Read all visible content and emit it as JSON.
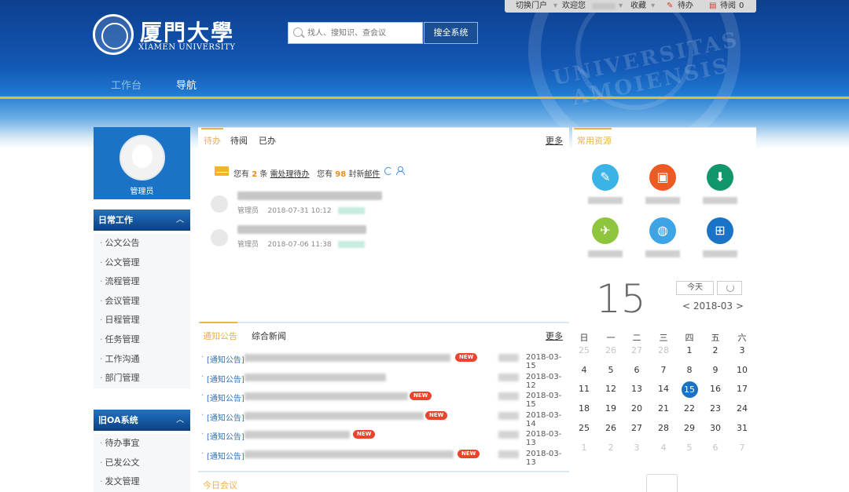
{
  "header": {
    "logo_cn": "厦門大學",
    "logo_en": "XIAMEN UNIVERSITY",
    "search_placeholder": "找人、搜知识、查会议",
    "search_button": "搜全系统",
    "seal_text": "UNIVERSITAS AMOIENSIS",
    "topbar": {
      "switch_portal": "切换门户",
      "welcome": "欢迎您",
      "favorites": "收藏",
      "todo_label": "待办",
      "todo_count": "",
      "toread_label": "待阅",
      "toread_count": "0"
    },
    "nav": [
      "工作台",
      "导航"
    ]
  },
  "sidebar": {
    "user_name": "管理员",
    "section1": {
      "title": "日常工作",
      "items": [
        "公文公告",
        "公文管理",
        "流程管理",
        "会议管理",
        "日程管理",
        "任务管理",
        "工作沟通",
        "部门管理"
      ]
    },
    "section2": {
      "title": "旧OA系统",
      "items": [
        "待办事宜",
        "已发公文",
        "发文管理"
      ]
    }
  },
  "todo": {
    "tabs": [
      "待办",
      "待阅",
      "已办"
    ],
    "more": "更多",
    "summary": {
      "you_have": "您有",
      "count": "2",
      "unit": "条",
      "link": "需处理待办",
      "you_have2": "您有",
      "mail_count": "98",
      "mail_unit": "封新",
      "mail_link": "邮件"
    },
    "items": [
      {
        "user": "管理员",
        "date": "2018-07-31 10:12"
      },
      {
        "user": "管理员",
        "date": "2018-07-06 11:38"
      }
    ]
  },
  "apps": {
    "title": "常用资源",
    "items": [
      {
        "icon": "document-edit-icon",
        "color": "#3cb3e6"
      },
      {
        "icon": "briefcase-icon",
        "color": "#ee5a24"
      },
      {
        "icon": "download-icon",
        "color": "#11956b"
      },
      {
        "icon": "airplane-icon",
        "color": "#8fc53c"
      },
      {
        "icon": "globe-icon",
        "color": "#3da5e6"
      },
      {
        "icon": "grid-icon",
        "color": "#1b73c8"
      }
    ]
  },
  "calendar": {
    "day": "15",
    "today_button": "今天",
    "month": "2018-03",
    "prev": "<",
    "next": ">",
    "weekdays": [
      "日",
      "一",
      "二",
      "三",
      "四",
      "五",
      "六"
    ],
    "weeks": [
      [
        "25",
        "26",
        "27",
        "28",
        "1",
        "2",
        "3"
      ],
      [
        "4",
        "5",
        "6",
        "7",
        "8",
        "9",
        "10"
      ],
      [
        "11",
        "12",
        "13",
        "14",
        "15",
        "16",
        "17"
      ],
      [
        "18",
        "19",
        "20",
        "21",
        "22",
        "23",
        "24"
      ],
      [
        "25",
        "26",
        "27",
        "28",
        "29",
        "30",
        "31"
      ],
      [
        "1",
        "2",
        "3",
        "4",
        "5",
        "6",
        "7"
      ]
    ],
    "selected": "15"
  },
  "news": {
    "tabs": [
      "通知公告",
      "综合新闻"
    ],
    "more": "更多",
    "new_badge": "NEW",
    "items": [
      {
        "category": "[通知公告]",
        "date": "2018-03-15",
        "is_new": true
      },
      {
        "category": "[通知公告]",
        "date": "2018-03-12",
        "is_new": false
      },
      {
        "category": "[通知公告]",
        "date": "2018-03-15",
        "is_new": true
      },
      {
        "category": "[通知公告]",
        "date": "2018-03-14",
        "is_new": true
      },
      {
        "category": "[通知公告]",
        "date": "2018-03-13",
        "is_new": true
      },
      {
        "category": "[通知公告]",
        "date": "2018-03-13",
        "is_new": true
      }
    ]
  },
  "meeting": {
    "title": "今日会议"
  }
}
